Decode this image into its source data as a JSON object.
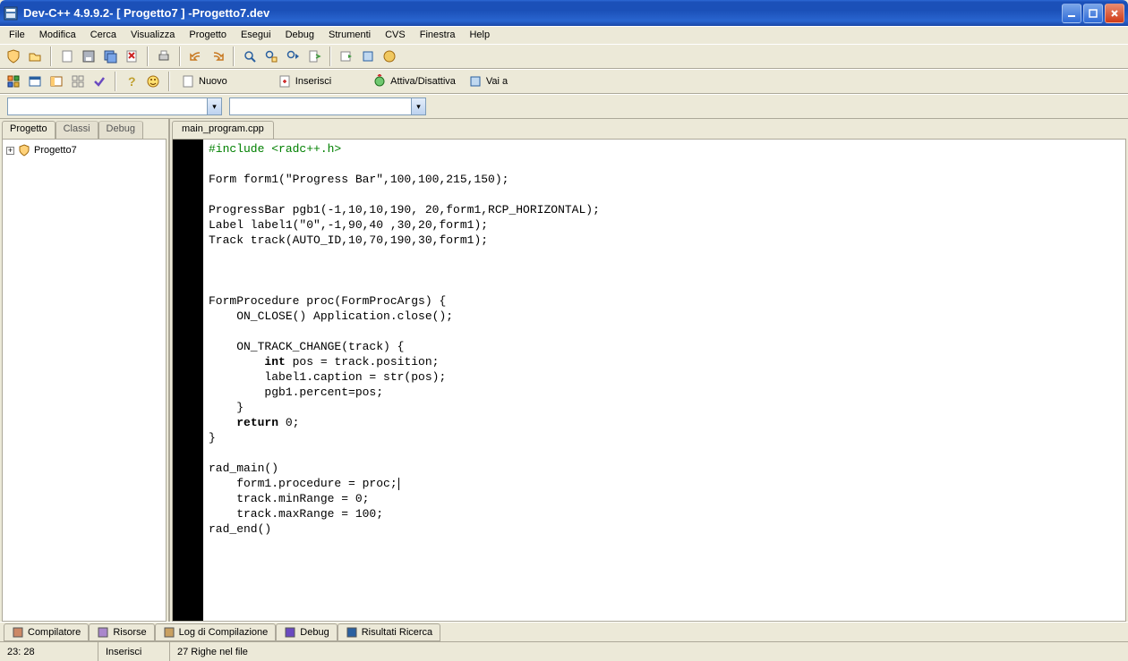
{
  "title": {
    "app": "Dev-C++ 4.9.9.2 ",
    "project": " - [ Progetto7 ] - ",
    "file": "Progetto7.dev"
  },
  "menu": [
    "File",
    "Modifica",
    "Cerca",
    "Visualizza",
    "Progetto",
    "Esegui",
    "Debug",
    "Strumenti",
    "CVS",
    "Finestra",
    "Help"
  ],
  "toolbar2": {
    "nuovo": "Nuovo",
    "inserisci": "Inserisci",
    "attiva": "Attiva/Disattiva",
    "vaia": "Vai a"
  },
  "side_tabs": [
    "Progetto",
    "Classi",
    "Debug"
  ],
  "tree": {
    "root": "Progetto7"
  },
  "editor_tab": "main_program.cpp",
  "code_lines": [
    {
      "t": "#include <radc++.h>",
      "cls": "kw-pre"
    },
    {
      "t": ""
    },
    {
      "t": "Form form1(\"Progress Bar\",100,100,215,150);"
    },
    {
      "t": ""
    },
    {
      "t": "ProgressBar pgb1(-1,10,10,190, 20,form1,RCP_HORIZONTAL);"
    },
    {
      "t": "Label label1(\"0\",-1,90,40 ,30,20,form1);"
    },
    {
      "t": "Track track(AUTO_ID,10,70,190,30,form1);"
    },
    {
      "t": ""
    },
    {
      "t": ""
    },
    {
      "t": ""
    },
    {
      "t": "FormProcedure proc(FormProcArgs) {"
    },
    {
      "t": "    ON_CLOSE() Application.close();"
    },
    {
      "t": ""
    },
    {
      "t": "    ON_TRACK_CHANGE(track) {"
    },
    {
      "t": "        int pos = track.position;",
      "bold_start": 8,
      "bold_end": 11
    },
    {
      "t": "        label1.caption = str(pos);"
    },
    {
      "t": "        pgb1.percent=pos;"
    },
    {
      "t": "    }"
    },
    {
      "t": "    return 0;",
      "bold_start": 4,
      "bold_end": 10
    },
    {
      "t": "}"
    },
    {
      "t": ""
    },
    {
      "t": "rad_main()"
    },
    {
      "t": "    form1.procedure = proc;",
      "highlight": true,
      "caret": true
    },
    {
      "t": "    track.minRange = 0;"
    },
    {
      "t": "    track.maxRange = 100;"
    },
    {
      "t": "rad_end()"
    },
    {
      "t": ""
    }
  ],
  "bottom_tabs": [
    "Compilatore",
    "Risorse",
    "Log di Compilazione",
    "Debug",
    "Risultati Ricerca"
  ],
  "status": {
    "cursor": "23: 28",
    "mode": "Inserisci",
    "lines": "27 Righe nel file"
  }
}
